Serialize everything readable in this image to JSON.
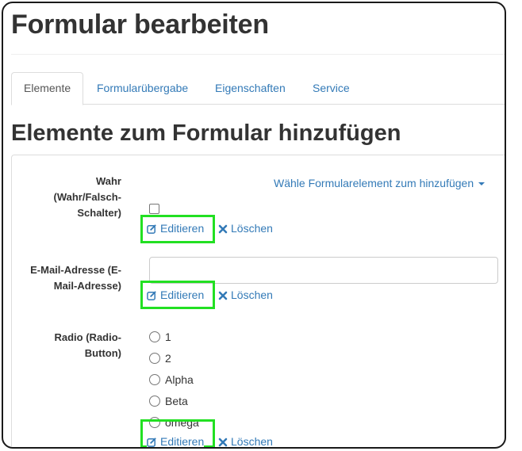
{
  "page": {
    "title": "Formular bearbeiten"
  },
  "tabs": [
    {
      "label": "Elemente",
      "active": true
    },
    {
      "label": "Formularübergabe",
      "active": false
    },
    {
      "label": "Eigenschaften",
      "active": false
    },
    {
      "label": "Service",
      "active": false
    }
  ],
  "section": {
    "title": "Elemente zum Formular hinzufügen",
    "add_dropdown_label": "Wähle Formularelement zum hinzufügen"
  },
  "fields": [
    {
      "label_line1": "Wahr",
      "label_line2": "(Wahr/Falsch-",
      "label_line3": "Schalter)",
      "checked": false
    },
    {
      "label_line1": "E-Mail-Adresse (E-",
      "label_line2": "Mail-Adresse)",
      "value": ""
    },
    {
      "label_line1": "Radio (Radio-",
      "label_line2": "Button)",
      "options": [
        "1",
        "2",
        "Alpha",
        "Beta",
        "omega"
      ]
    }
  ],
  "actions": {
    "edit_label": "Editieren",
    "delete_label": "Löschen"
  },
  "colors": {
    "link": "#337ab7",
    "highlight": "#22e022",
    "text": "#333333",
    "border": "#dddddd"
  },
  "icons": {
    "edit": "edit-icon",
    "delete": "delete-x-icon",
    "dropdown": "caret-down-icon"
  }
}
